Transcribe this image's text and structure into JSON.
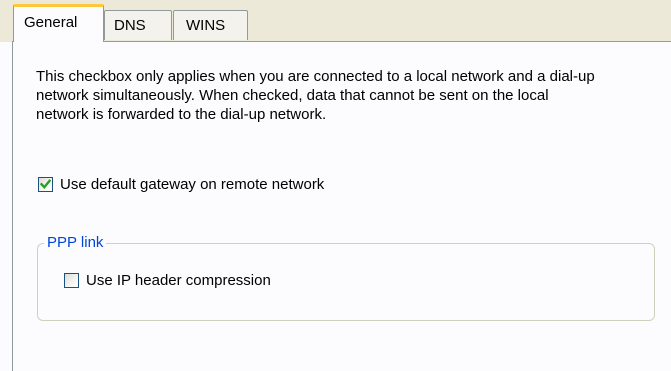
{
  "tabs": [
    {
      "label": "General",
      "active": true
    },
    {
      "label": "DNS",
      "active": false
    },
    {
      "label": "WINS",
      "active": false
    }
  ],
  "general": {
    "description": "This checkbox only applies when you are connected to a local network and a dial-up network simultaneously.  When checked, data that cannot be sent on the local network is forwarded to the dial-up network.",
    "default_gateway": {
      "label": "Use default gateway on remote network",
      "checked": true
    },
    "ppp_group": {
      "title": "PPP link",
      "ip_header_compression": {
        "label": "Use IP header compression",
        "checked": false
      }
    }
  },
  "colors": {
    "active_tab_accent": "#ffc83c",
    "groupbox_title": "#0046d5",
    "check_mark": "#21a121"
  },
  "icons": {
    "checked": "check-mark-icon"
  }
}
